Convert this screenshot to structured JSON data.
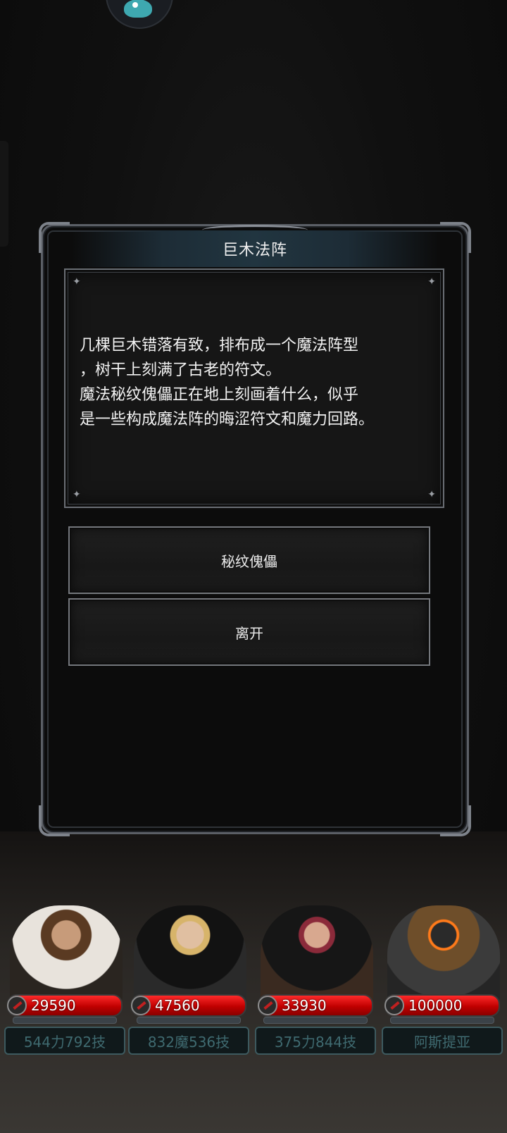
{
  "event": {
    "title": "巨木法阵",
    "story_lines": [
      "几棵巨木错落有致，排布成一个魔法阵型",
      "，树干上刻满了古老的符文。",
      "魔法秘纹傀儡正在地上刻画着什么，似乎",
      "是一些构成魔法阵的晦涩符文和魔力回路。"
    ],
    "choices": [
      "秘纹傀儡",
      "离开"
    ]
  },
  "party": [
    {
      "hp": "29590",
      "stats": "544力792技"
    },
    {
      "hp": "47560",
      "stats": "832魔536技"
    },
    {
      "hp": "33930",
      "stats": "375力844技"
    },
    {
      "hp": "100000",
      "stats": "阿斯提亚"
    }
  ],
  "colors": {
    "hp_bar": "#c00000",
    "stat_text": "#3f6a70",
    "frame": "#5b5f66"
  },
  "icons": {
    "hp": "sword-icon",
    "sparkle": "sparkle-icon"
  }
}
